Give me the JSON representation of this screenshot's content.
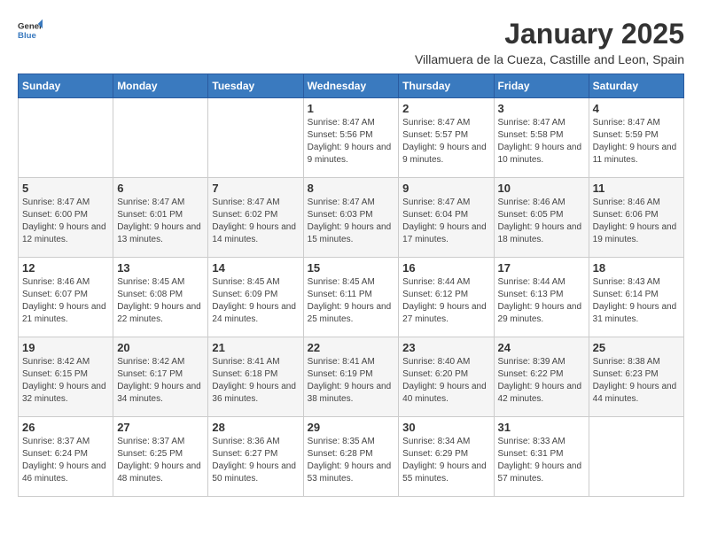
{
  "logo": {
    "general": "General",
    "blue": "Blue"
  },
  "title": "January 2025",
  "subtitle": "Villamuera de la Cueza, Castille and Leon, Spain",
  "days_of_week": [
    "Sunday",
    "Monday",
    "Tuesday",
    "Wednesday",
    "Thursday",
    "Friday",
    "Saturday"
  ],
  "weeks": [
    [
      {
        "day": "",
        "sunrise": "",
        "sunset": "",
        "daylight": ""
      },
      {
        "day": "",
        "sunrise": "",
        "sunset": "",
        "daylight": ""
      },
      {
        "day": "",
        "sunrise": "",
        "sunset": "",
        "daylight": ""
      },
      {
        "day": "1",
        "sunrise": "Sunrise: 8:47 AM",
        "sunset": "Sunset: 5:56 PM",
        "daylight": "Daylight: 9 hours and 9 minutes."
      },
      {
        "day": "2",
        "sunrise": "Sunrise: 8:47 AM",
        "sunset": "Sunset: 5:57 PM",
        "daylight": "Daylight: 9 hours and 9 minutes."
      },
      {
        "day": "3",
        "sunrise": "Sunrise: 8:47 AM",
        "sunset": "Sunset: 5:58 PM",
        "daylight": "Daylight: 9 hours and 10 minutes."
      },
      {
        "day": "4",
        "sunrise": "Sunrise: 8:47 AM",
        "sunset": "Sunset: 5:59 PM",
        "daylight": "Daylight: 9 hours and 11 minutes."
      }
    ],
    [
      {
        "day": "5",
        "sunrise": "Sunrise: 8:47 AM",
        "sunset": "Sunset: 6:00 PM",
        "daylight": "Daylight: 9 hours and 12 minutes."
      },
      {
        "day": "6",
        "sunrise": "Sunrise: 8:47 AM",
        "sunset": "Sunset: 6:01 PM",
        "daylight": "Daylight: 9 hours and 13 minutes."
      },
      {
        "day": "7",
        "sunrise": "Sunrise: 8:47 AM",
        "sunset": "Sunset: 6:02 PM",
        "daylight": "Daylight: 9 hours and 14 minutes."
      },
      {
        "day": "8",
        "sunrise": "Sunrise: 8:47 AM",
        "sunset": "Sunset: 6:03 PM",
        "daylight": "Daylight: 9 hours and 15 minutes."
      },
      {
        "day": "9",
        "sunrise": "Sunrise: 8:47 AM",
        "sunset": "Sunset: 6:04 PM",
        "daylight": "Daylight: 9 hours and 17 minutes."
      },
      {
        "day": "10",
        "sunrise": "Sunrise: 8:46 AM",
        "sunset": "Sunset: 6:05 PM",
        "daylight": "Daylight: 9 hours and 18 minutes."
      },
      {
        "day": "11",
        "sunrise": "Sunrise: 8:46 AM",
        "sunset": "Sunset: 6:06 PM",
        "daylight": "Daylight: 9 hours and 19 minutes."
      }
    ],
    [
      {
        "day": "12",
        "sunrise": "Sunrise: 8:46 AM",
        "sunset": "Sunset: 6:07 PM",
        "daylight": "Daylight: 9 hours and 21 minutes."
      },
      {
        "day": "13",
        "sunrise": "Sunrise: 8:45 AM",
        "sunset": "Sunset: 6:08 PM",
        "daylight": "Daylight: 9 hours and 22 minutes."
      },
      {
        "day": "14",
        "sunrise": "Sunrise: 8:45 AM",
        "sunset": "Sunset: 6:09 PM",
        "daylight": "Daylight: 9 hours and 24 minutes."
      },
      {
        "day": "15",
        "sunrise": "Sunrise: 8:45 AM",
        "sunset": "Sunset: 6:11 PM",
        "daylight": "Daylight: 9 hours and 25 minutes."
      },
      {
        "day": "16",
        "sunrise": "Sunrise: 8:44 AM",
        "sunset": "Sunset: 6:12 PM",
        "daylight": "Daylight: 9 hours and 27 minutes."
      },
      {
        "day": "17",
        "sunrise": "Sunrise: 8:44 AM",
        "sunset": "Sunset: 6:13 PM",
        "daylight": "Daylight: 9 hours and 29 minutes."
      },
      {
        "day": "18",
        "sunrise": "Sunrise: 8:43 AM",
        "sunset": "Sunset: 6:14 PM",
        "daylight": "Daylight: 9 hours and 31 minutes."
      }
    ],
    [
      {
        "day": "19",
        "sunrise": "Sunrise: 8:42 AM",
        "sunset": "Sunset: 6:15 PM",
        "daylight": "Daylight: 9 hours and 32 minutes."
      },
      {
        "day": "20",
        "sunrise": "Sunrise: 8:42 AM",
        "sunset": "Sunset: 6:17 PM",
        "daylight": "Daylight: 9 hours and 34 minutes."
      },
      {
        "day": "21",
        "sunrise": "Sunrise: 8:41 AM",
        "sunset": "Sunset: 6:18 PM",
        "daylight": "Daylight: 9 hours and 36 minutes."
      },
      {
        "day": "22",
        "sunrise": "Sunrise: 8:41 AM",
        "sunset": "Sunset: 6:19 PM",
        "daylight": "Daylight: 9 hours and 38 minutes."
      },
      {
        "day": "23",
        "sunrise": "Sunrise: 8:40 AM",
        "sunset": "Sunset: 6:20 PM",
        "daylight": "Daylight: 9 hours and 40 minutes."
      },
      {
        "day": "24",
        "sunrise": "Sunrise: 8:39 AM",
        "sunset": "Sunset: 6:22 PM",
        "daylight": "Daylight: 9 hours and 42 minutes."
      },
      {
        "day": "25",
        "sunrise": "Sunrise: 8:38 AM",
        "sunset": "Sunset: 6:23 PM",
        "daylight": "Daylight: 9 hours and 44 minutes."
      }
    ],
    [
      {
        "day": "26",
        "sunrise": "Sunrise: 8:37 AM",
        "sunset": "Sunset: 6:24 PM",
        "daylight": "Daylight: 9 hours and 46 minutes."
      },
      {
        "day": "27",
        "sunrise": "Sunrise: 8:37 AM",
        "sunset": "Sunset: 6:25 PM",
        "daylight": "Daylight: 9 hours and 48 minutes."
      },
      {
        "day": "28",
        "sunrise": "Sunrise: 8:36 AM",
        "sunset": "Sunset: 6:27 PM",
        "daylight": "Daylight: 9 hours and 50 minutes."
      },
      {
        "day": "29",
        "sunrise": "Sunrise: 8:35 AM",
        "sunset": "Sunset: 6:28 PM",
        "daylight": "Daylight: 9 hours and 53 minutes."
      },
      {
        "day": "30",
        "sunrise": "Sunrise: 8:34 AM",
        "sunset": "Sunset: 6:29 PM",
        "daylight": "Daylight: 9 hours and 55 minutes."
      },
      {
        "day": "31",
        "sunrise": "Sunrise: 8:33 AM",
        "sunset": "Sunset: 6:31 PM",
        "daylight": "Daylight: 9 hours and 57 minutes."
      },
      {
        "day": "",
        "sunrise": "",
        "sunset": "",
        "daylight": ""
      }
    ]
  ]
}
